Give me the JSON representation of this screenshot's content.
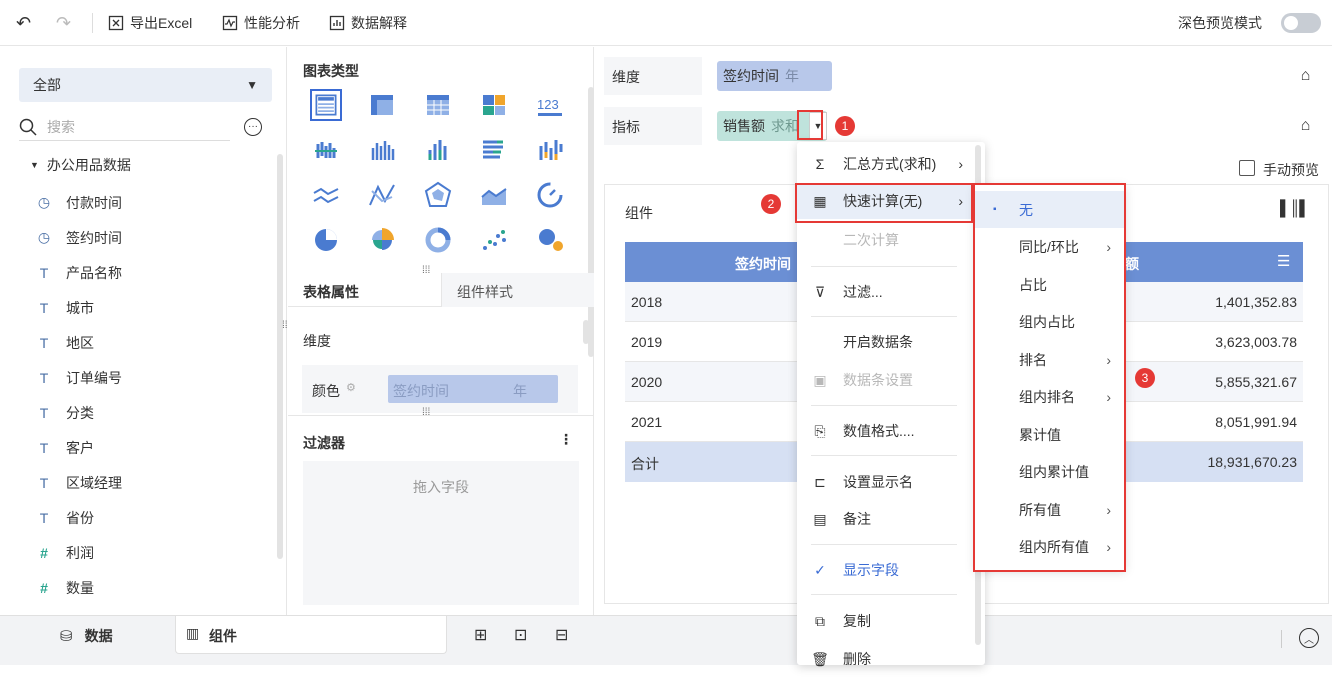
{
  "toolbar": {
    "export": "导出Excel",
    "perf": "性能分析",
    "explain": "数据解释",
    "dark_preview": "深色预览模式"
  },
  "left": {
    "dataset_select": "全部",
    "search_placeholder": "搜索",
    "folder": "办公用品数据",
    "fields": [
      {
        "icon": "clock",
        "name": "付款时间"
      },
      {
        "icon": "clock",
        "name": "签约时间"
      },
      {
        "icon": "text",
        "name": "产品名称"
      },
      {
        "icon": "text",
        "name": "城市"
      },
      {
        "icon": "text",
        "name": "地区"
      },
      {
        "icon": "text",
        "name": "订单编号"
      },
      {
        "icon": "text",
        "name": "分类"
      },
      {
        "icon": "text",
        "name": "客户"
      },
      {
        "icon": "text",
        "name": "区域经理"
      },
      {
        "icon": "text",
        "name": "省份"
      },
      {
        "icon": "hash",
        "name": "利润"
      },
      {
        "icon": "hash",
        "name": "数量"
      }
    ]
  },
  "mid": {
    "chart_type_title": "图表类型",
    "tab_table_props": "表格属性",
    "tab_component_style": "组件样式",
    "dimension_label": "维度",
    "color_label": "颜色",
    "color_pill_field": "签约时间",
    "color_pill_unit": "年",
    "filter_title": "过滤器",
    "filter_drop": "拖入字段",
    "kpi_icon_text": "123"
  },
  "right": {
    "dim_label": "维度",
    "dim_pill": "签约时间",
    "dim_pill_unit": "年",
    "metric_label": "指标",
    "metric_pill": "销售额",
    "metric_pill_agg": "求和",
    "manual_preview": "手动预览",
    "component_title": "组件",
    "table": {
      "col1": "签约时间",
      "col2": "额",
      "rows": [
        {
          "year": "2018",
          "value": "1,401,352.83"
        },
        {
          "year": "2019",
          "value": "3,623,003.78"
        },
        {
          "year": "2020",
          "value": "5,855,321.67"
        },
        {
          "year": "2021",
          "value": "8,051,991.94"
        }
      ],
      "total_label": "合计",
      "total_value": "18,931,670.23"
    }
  },
  "menu": {
    "items": [
      "汇总方式(求和)",
      "快速计算(无)",
      "二次计算",
      "过滤...",
      "开启数据条",
      "数据条设置",
      "数值格式....",
      "设置显示名",
      "备注",
      "显示字段",
      "复制",
      "删除"
    ]
  },
  "submenu": {
    "items": [
      "无",
      "同比/环比",
      "占比",
      "组内占比",
      "排名",
      "组内排名",
      "累计值",
      "组内累计值",
      "所有值",
      "组内所有值"
    ]
  },
  "badges": [
    "1",
    "2",
    "3"
  ],
  "bottom": {
    "data_tab": "数据",
    "component_tab": "组件"
  },
  "colors": {
    "accent": "#3a6bd4",
    "header_blue": "#6b8fd4",
    "pill_blue": "#b8c8ea",
    "pill_green": "#bfe3dc",
    "red": "#e53935"
  }
}
